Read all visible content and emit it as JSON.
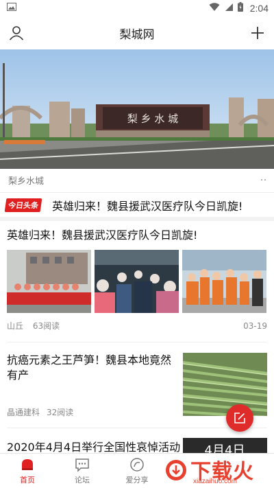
{
  "status_bar": {
    "time": "2:04"
  },
  "header": {
    "title": "梨城网"
  },
  "banner": {
    "caption": "梨乡水城",
    "gate_text": "梨 乡 水 城"
  },
  "ticker": {
    "badge": "今日头条",
    "text": "英雄归来！魏县援武汉医疗队今日凯旋!"
  },
  "articles": [
    {
      "title": "英雄归来！魏县援武汉医疗队今日凯旋!",
      "source": "山丘",
      "reads": "63阅读",
      "date": "03-19"
    },
    {
      "title": "抗癌元素之王芦笋！魏县本地竟然有产",
      "source": "晶通建科",
      "reads": "32阅读"
    },
    {
      "title": "2020年4月4日举行全国性哀悼活动",
      "thumb_text": "4月4日"
    }
  ],
  "tabs": [
    {
      "label": "首页",
      "active": true
    },
    {
      "label": "论坛",
      "active": false
    },
    {
      "label": "爱分享",
      "active": false
    },
    {
      "label": "",
      "active": false
    },
    {
      "label": "",
      "active": false
    }
  ],
  "watermark": {
    "text": "下载火",
    "sub": "xiazaihuo.com"
  },
  "colors": {
    "accent": "#e02020",
    "fab": "#e02b2b",
    "watermark": "#e8402f"
  }
}
